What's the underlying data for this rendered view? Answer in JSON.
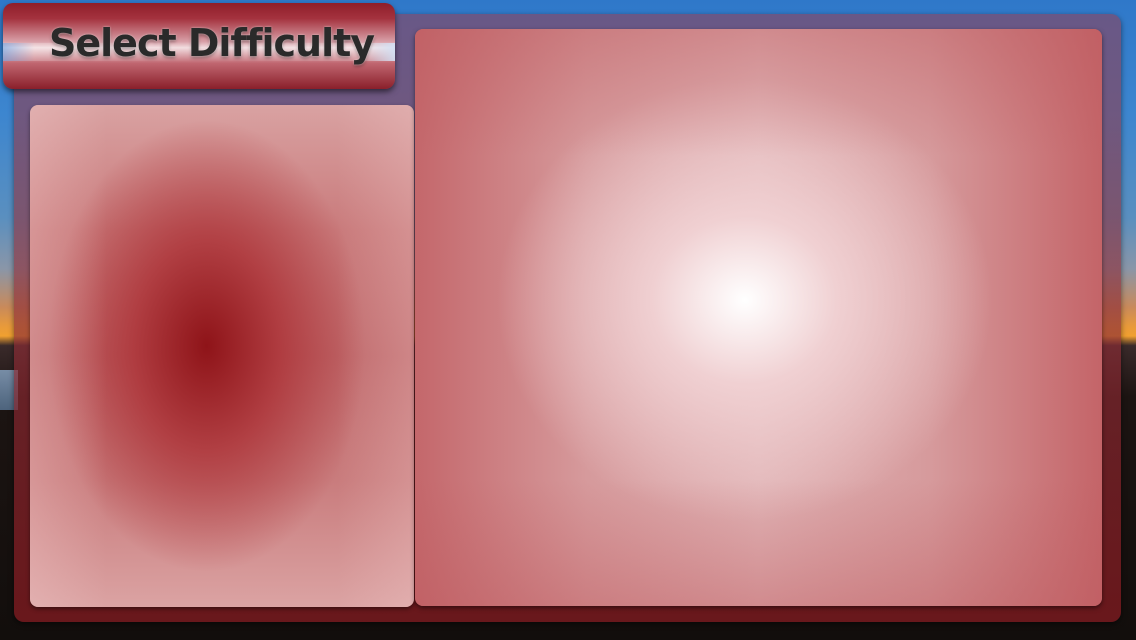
{
  "screen": {
    "title": "Select Difficulty"
  },
  "colors": {
    "panel_accent": "#a4323e",
    "left_pane_center": "#8c0f14",
    "right_pane_center": "#ffffff",
    "title_text": "#2a2a2a"
  },
  "left_pane": {
    "state": "empty"
  },
  "right_pane": {
    "state": "empty"
  }
}
